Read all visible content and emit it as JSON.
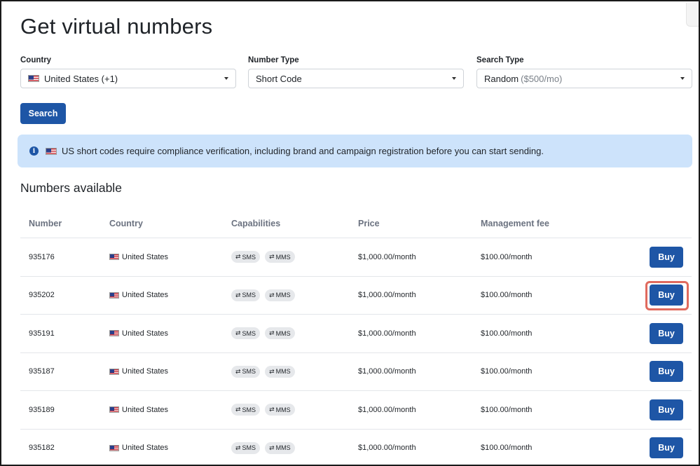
{
  "page": {
    "title": "Get virtual numbers"
  },
  "filters": {
    "country": {
      "label": "Country",
      "value": "United States (+1)"
    },
    "number_type": {
      "label": "Number Type",
      "value": "Short Code"
    },
    "search_type": {
      "label": "Search Type",
      "value": "Random",
      "value_suffix": "($500/mo)"
    }
  },
  "search_button": {
    "label": "Search"
  },
  "banner": {
    "text": "US short codes require compliance verification, including brand and campaign registration before you can start sending."
  },
  "numbers": {
    "title": "Numbers available",
    "columns": [
      "Number",
      "Country",
      "Capabilities",
      "Price",
      "Management fee"
    ],
    "buy_label": "Buy",
    "rows": [
      {
        "number": "935176",
        "country": "United States",
        "caps": [
          "SMS",
          "MMS"
        ],
        "price": "$1,000.00/month",
        "fee": "$100.00/month"
      },
      {
        "number": "935202",
        "country": "United States",
        "caps": [
          "SMS",
          "MMS"
        ],
        "price": "$1,000.00/month",
        "fee": "$100.00/month",
        "highlighted": true
      },
      {
        "number": "935191",
        "country": "United States",
        "caps": [
          "SMS",
          "MMS"
        ],
        "price": "$1,000.00/month",
        "fee": "$100.00/month"
      },
      {
        "number": "935187",
        "country": "United States",
        "caps": [
          "SMS",
          "MMS"
        ],
        "price": "$1,000.00/month",
        "fee": "$100.00/month"
      },
      {
        "number": "935189",
        "country": "United States",
        "caps": [
          "SMS",
          "MMS"
        ],
        "price": "$1,000.00/month",
        "fee": "$100.00/month"
      },
      {
        "number": "935182",
        "country": "United States",
        "caps": [
          "SMS",
          "MMS"
        ],
        "price": "$1,000.00/month",
        "fee": "$100.00/month"
      }
    ]
  },
  "colors": {
    "primary": "#1e56a6",
    "banner_bg": "#cde3fb",
    "highlight": "#e06a5e"
  }
}
